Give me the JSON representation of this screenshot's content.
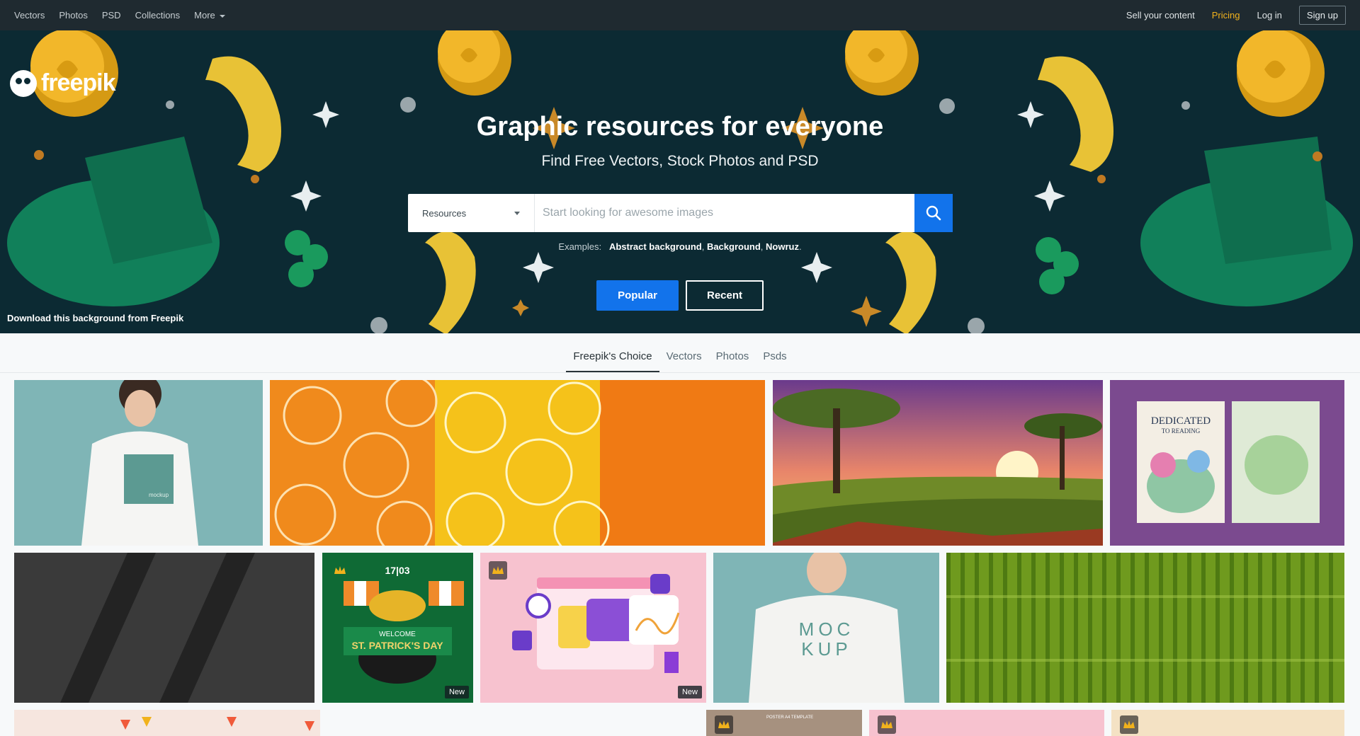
{
  "nav": {
    "left": [
      "Vectors",
      "Photos",
      "PSD",
      "Collections",
      "More"
    ],
    "sell": "Sell your content",
    "pricing": "Pricing",
    "login": "Log in",
    "signup": "Sign up"
  },
  "hero": {
    "logo": "freepik",
    "title": "Graphic resources for everyone",
    "subtitle": "Find Free Vectors, Stock Photos and PSD",
    "search": {
      "selected": "Resources",
      "placeholder": "Start looking for awesome images"
    },
    "examples_label": "Examples:",
    "examples": [
      "Abstract background",
      "Background",
      "Nowruz"
    ],
    "popular": "Popular",
    "recent": "Recent",
    "credit": "Download this background from Freepik"
  },
  "tabs": [
    "Freepik's Choice",
    "Vectors",
    "Photos",
    "Psds"
  ],
  "tiles": {
    "tshirt_label": "mockup",
    "book_title": "DEDICATED",
    "book_sub": "TO READING",
    "stpat_date": "17|03",
    "stpat_welcome": "WELCOME",
    "stpat_title": "ST. PATRICK'S DAY",
    "mockup_text_1": "MOC",
    "mockup_text_2": "KUP",
    "new_badge": "New",
    "poster_label": "POSTER A4 TEMPLATE"
  },
  "colors": {
    "accent": "#1273eb",
    "pricing": "#f1b21c",
    "hero_bg": "#0c2a33"
  }
}
